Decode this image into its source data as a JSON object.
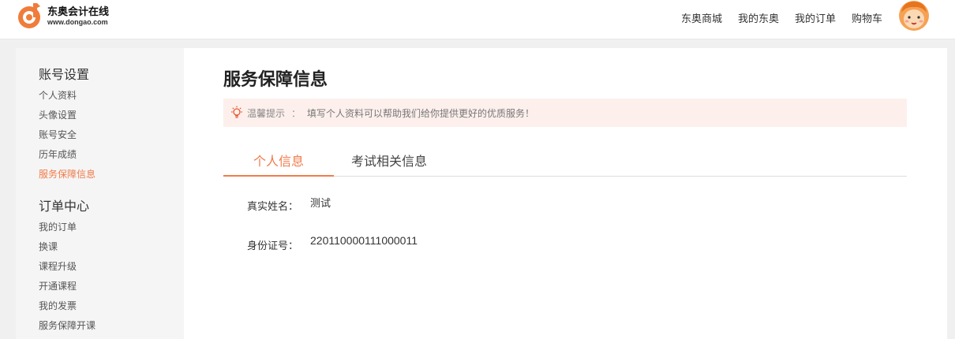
{
  "header": {
    "logo_name": "东奥会计在线",
    "logo_url": "www.dongao.com",
    "nav": [
      {
        "label": "东奥商城"
      },
      {
        "label": "我的东奥"
      },
      {
        "label": "我的订单"
      },
      {
        "label": "购物车"
      }
    ]
  },
  "sidebar": {
    "groups": [
      {
        "title": "账号设置",
        "items": [
          {
            "label": "个人资料"
          },
          {
            "label": "头像设置"
          },
          {
            "label": "账号安全"
          },
          {
            "label": "历年成绩"
          },
          {
            "label": "服务保障信息"
          }
        ]
      },
      {
        "title": "订单中心",
        "items": [
          {
            "label": "我的订单"
          },
          {
            "label": "换课"
          },
          {
            "label": "课程升级"
          },
          {
            "label": "开通课程"
          },
          {
            "label": "我的发票"
          },
          {
            "label": "服务保障开课"
          }
        ]
      }
    ]
  },
  "main": {
    "title": "服务保障信息",
    "tip": {
      "label": "温馨提示",
      "separator": "：",
      "text": "填写个人资料可以帮助我们给你提供更好的优质服务！"
    },
    "tabs": [
      {
        "label": "个人信息"
      },
      {
        "label": "考试相关信息"
      }
    ],
    "fields": [
      {
        "label": "真实姓名：",
        "value": "测试"
      },
      {
        "label": "身份证号：",
        "value": "220110000111000011"
      }
    ]
  },
  "colors": {
    "accent": "#f07c4a",
    "tip_bg": "#fdf0ec",
    "sidebar_bg": "#f5f5f5",
    "page_bg": "#f0f0f0"
  }
}
